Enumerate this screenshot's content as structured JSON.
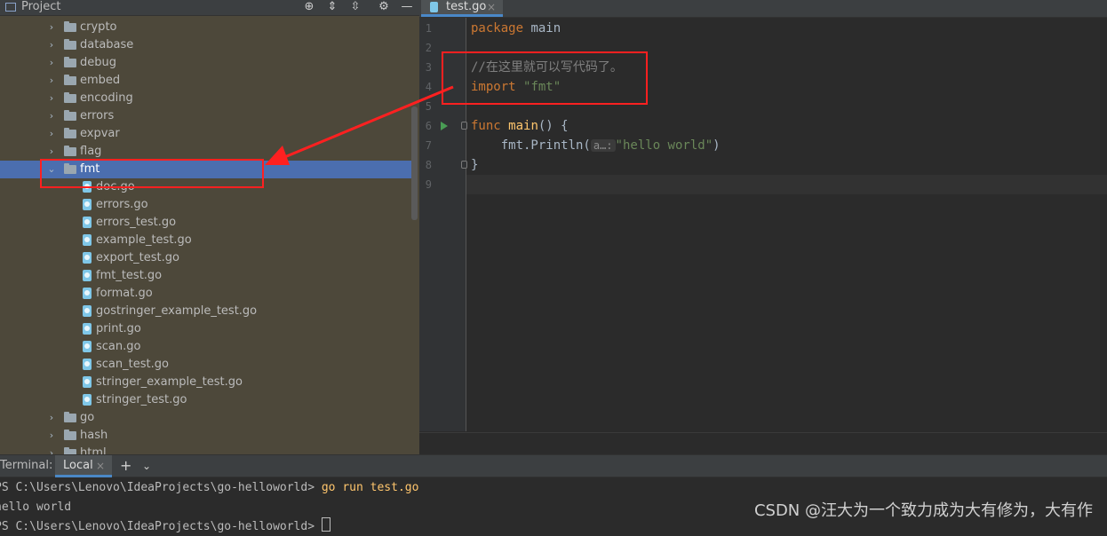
{
  "project_panel": {
    "title": "Project",
    "toolbar_icons": [
      "crosshair-icon",
      "expand-all-icon",
      "collapse-all-icon",
      "gear-icon",
      "minimize-icon"
    ],
    "tree": [
      {
        "label": "crypto",
        "type": "folder",
        "expanded": false
      },
      {
        "label": "database",
        "type": "folder",
        "expanded": false
      },
      {
        "label": "debug",
        "type": "folder",
        "expanded": false
      },
      {
        "label": "embed",
        "type": "folder",
        "expanded": false
      },
      {
        "label": "encoding",
        "type": "folder",
        "expanded": false
      },
      {
        "label": "errors",
        "type": "folder",
        "expanded": false
      },
      {
        "label": "expvar",
        "type": "folder",
        "expanded": false
      },
      {
        "label": "flag",
        "type": "folder",
        "expanded": false
      },
      {
        "label": "fmt",
        "type": "folder",
        "expanded": true,
        "selected": true
      },
      {
        "label": "doc.go",
        "type": "file"
      },
      {
        "label": "errors.go",
        "type": "file"
      },
      {
        "label": "errors_test.go",
        "type": "file"
      },
      {
        "label": "example_test.go",
        "type": "file"
      },
      {
        "label": "export_test.go",
        "type": "file"
      },
      {
        "label": "fmt_test.go",
        "type": "file"
      },
      {
        "label": "format.go",
        "type": "file"
      },
      {
        "label": "gostringer_example_test.go",
        "type": "file"
      },
      {
        "label": "print.go",
        "type": "file"
      },
      {
        "label": "scan.go",
        "type": "file"
      },
      {
        "label": "scan_test.go",
        "type": "file"
      },
      {
        "label": "stringer_example_test.go",
        "type": "file"
      },
      {
        "label": "stringer_test.go",
        "type": "file"
      },
      {
        "label": "go",
        "type": "folder",
        "expanded": false
      },
      {
        "label": "hash",
        "type": "folder",
        "expanded": false
      },
      {
        "label": "html",
        "type": "folder",
        "expanded": false
      }
    ]
  },
  "editor": {
    "tab": {
      "label": "test.go",
      "close": "×"
    },
    "line_numbers": [
      "1",
      "2",
      "3",
      "4",
      "5",
      "6",
      "7",
      "8",
      "9"
    ],
    "code": {
      "l1_kw": "package",
      "l1_rest": " main",
      "l3_comment": "//在这里就可以写代码了。",
      "l4_kw": "import",
      "l4_str": "\"fmt\"",
      "l6_kw": "func",
      "l6_fn": "main",
      "l6_rest": "() {",
      "l7_pre": "    fmt.Println(",
      "l7_hint": "a…:",
      "l7_str": "\"hello world\"",
      "l7_post": ")",
      "l8": "}"
    }
  },
  "terminal": {
    "title": "Terminal:",
    "tab_local": "Local",
    "tab_close": "×",
    "add": "+",
    "dropdown": "⌄",
    "prompt1": "PS C:\\Users\\Lenovo\\IdeaProjects\\go-helloworld> ",
    "command1": "go run test.go",
    "output1": "hello world",
    "prompt2": "PS C:\\Users\\Lenovo\\IdeaProjects\\go-helloworld> "
  },
  "watermark": "CSDN @汪大为一个致力成为大有修为，大有作",
  "colors": {
    "annotation": "#ff2020",
    "selection": "#4b6eaf",
    "project_bg": "#4d483a",
    "editor_bg": "#2b2b2b"
  }
}
